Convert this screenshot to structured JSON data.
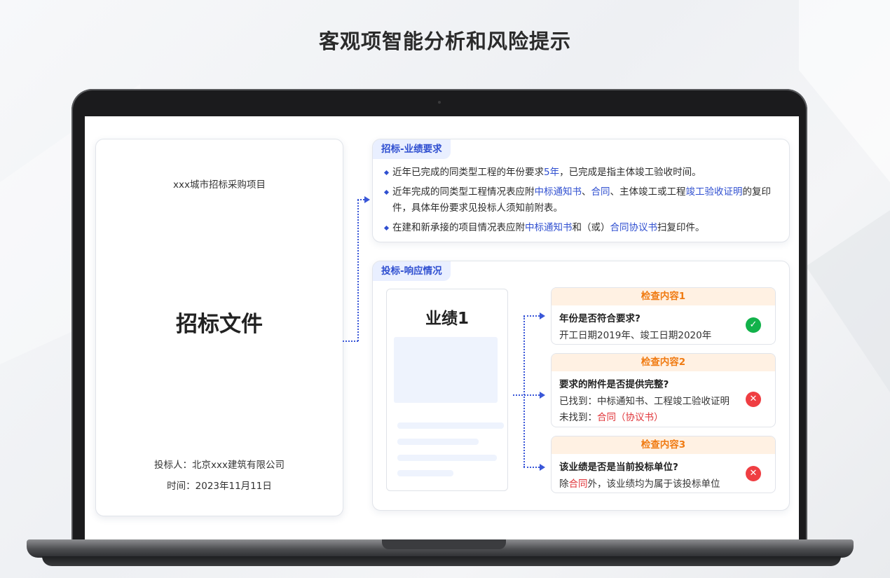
{
  "page_title": "客观项智能分析和风险提示",
  "document": {
    "project": "xxx城市招标采购项目",
    "title": "招标文件",
    "bidder": "投标人：北京xxx建筑有限公司",
    "time": "时间：2023年11月11日"
  },
  "tender_requirements": {
    "tag": "招标-业绩要求",
    "items": [
      {
        "p1": "近年已完成的同类型工程的年份要求",
        "h1": "5年",
        "p2": "，已完成是指主体竣工验收时间。"
      },
      {
        "p1": "近年完成的同类型工程情况表应附",
        "h1": "中标通知书",
        "p2": "、",
        "h2": "合同",
        "p3": "、主体竣工或工程",
        "h3": "竣工验收证明",
        "p4": "的复印件，具体年份要求见投标人须知前附表。"
      },
      {
        "p1": "在建和新承接的项目情况表应附",
        "h1": "中标通知书",
        "p2": "和（或）",
        "h2": "合同协议书",
        "p3": "扫复印件。"
      }
    ]
  },
  "bid_response": {
    "tag": "投标-响应情况",
    "doc_title": "业绩1",
    "checks": [
      {
        "header": "检查内容1",
        "question": "年份是否符合要求?",
        "line1": "开工日期2019年、竣工日期2020年",
        "status": "pass",
        "status_icon": "check-icon",
        "color": "#12b24a"
      },
      {
        "header": "检查内容2",
        "question": "要求的附件是否提供完整?",
        "line1": "已找到：中标通知书、工程竣工验收证明",
        "line2_prefix": "未找到：",
        "line2_red": "合同（协议书）",
        "status": "fail",
        "status_icon": "cross-icon",
        "color": "#ef3e42"
      },
      {
        "header": "检查内容3",
        "question": "该业绩是否是当前投标单位?",
        "line1_prefix": "除",
        "line1_red": "合同",
        "line1_suffix": "外，该业绩均为属于该投标单位",
        "status": "fail",
        "status_icon": "cross-icon",
        "color": "#ef3e42"
      }
    ]
  },
  "colors": {
    "accent": "#2f4fd0",
    "warning_header": "#f07b12",
    "pass": "#12b24a",
    "fail": "#ef3e42"
  }
}
